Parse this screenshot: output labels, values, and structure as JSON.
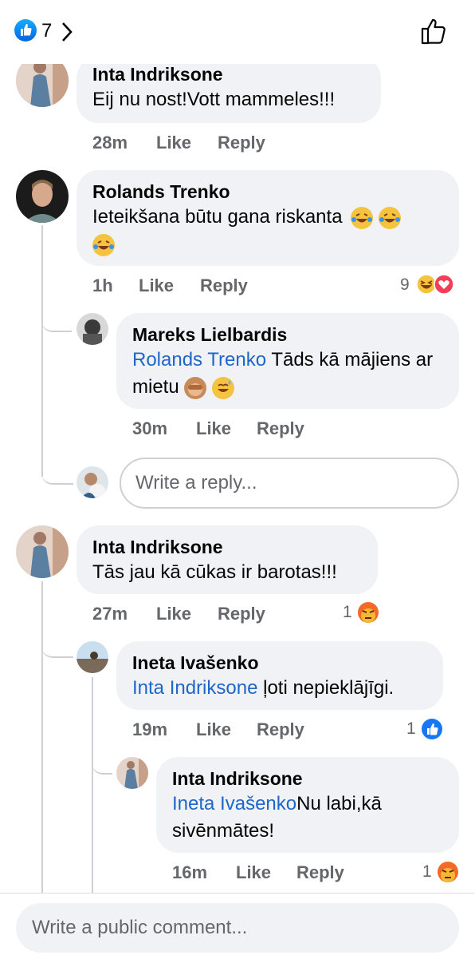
{
  "header": {
    "like_count": "7"
  },
  "comments": [
    {
      "name": "Inta Indriksone",
      "text": "Eij nu nost!Vott mammeles!!!",
      "time": "28m",
      "like": "Like",
      "reply": "Reply"
    },
    {
      "name": "Rolands Trenko",
      "text": "Ieteikšana būtu gana riskanta",
      "time": "1h",
      "like": "Like",
      "reply": "Reply",
      "reactions": "9",
      "replies": [
        {
          "name": "Mareks Lielbardis",
          "mention": "Rolands Trenko",
          "text": " Tāds kā mājiens ar mietu",
          "time": "30m",
          "like": "Like",
          "reply": "Reply"
        }
      ]
    },
    {
      "name": "Inta Indriksone",
      "text": "Tās jau kā cūkas ir barotas!!!",
      "time": "27m",
      "like": "Like",
      "reply": "Reply",
      "reactions": "1",
      "replies": [
        {
          "name": "Ineta Ivašenko",
          "mention": "Inta Indriksone",
          "text": " ļoti nepieklājīgi.",
          "time": "19m",
          "like": "Like",
          "reply": "Reply",
          "reactions": "1"
        },
        {
          "name": "Inta Indriksone",
          "mention": "Ineta Ivašenko",
          "text": "Nu labi,kā sivēnmātes!",
          "time": "16m",
          "like": "Like",
          "reply": "Reply",
          "reactions": "1"
        }
      ]
    }
  ],
  "reply_input": {
    "placeholder": "Write a reply..."
  },
  "comment_input": {
    "placeholder": "Write a public comment..."
  },
  "colors": {
    "mention": "#1f66c8",
    "bubble": "#f0f2f5",
    "like_blue": "#1877f2",
    "meta_gray": "#65676b"
  }
}
